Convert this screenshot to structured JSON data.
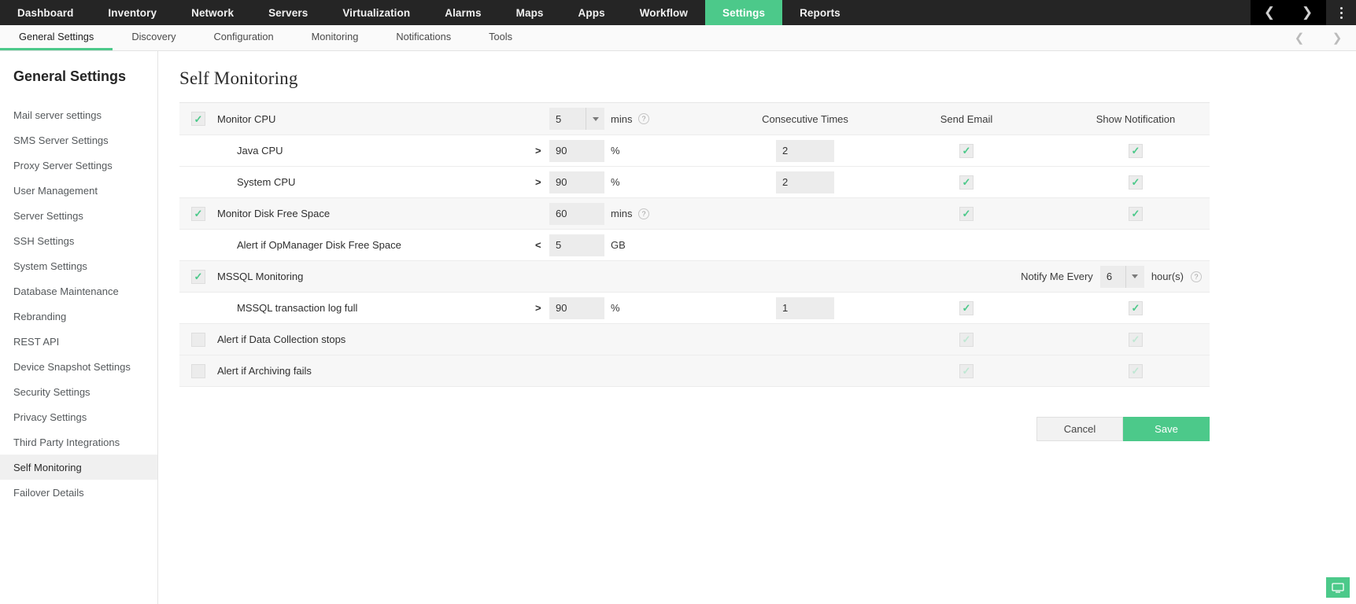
{
  "topnav": {
    "items": [
      {
        "label": "Dashboard",
        "active": false
      },
      {
        "label": "Inventory",
        "active": false
      },
      {
        "label": "Network",
        "active": false
      },
      {
        "label": "Servers",
        "active": false
      },
      {
        "label": "Virtualization",
        "active": false
      },
      {
        "label": "Alarms",
        "active": false
      },
      {
        "label": "Maps",
        "active": false
      },
      {
        "label": "Apps",
        "active": false
      },
      {
        "label": "Workflow",
        "active": false
      },
      {
        "label": "Settings",
        "active": true
      },
      {
        "label": "Reports",
        "active": false
      }
    ],
    "prev_icon": "chevron-left-icon",
    "next_icon": "chevron-right-icon",
    "kebab_icon": "more-vertical-icon"
  },
  "subnav": {
    "items": [
      {
        "label": "General Settings",
        "active": true
      },
      {
        "label": "Discovery",
        "active": false
      },
      {
        "label": "Configuration",
        "active": false
      },
      {
        "label": "Monitoring",
        "active": false
      },
      {
        "label": "Notifications",
        "active": false
      },
      {
        "label": "Tools",
        "active": false
      }
    ]
  },
  "sidebar": {
    "title": "General Settings",
    "items": [
      {
        "label": "Mail server settings",
        "active": false
      },
      {
        "label": "SMS Server Settings",
        "active": false
      },
      {
        "label": "Proxy Server Settings",
        "active": false
      },
      {
        "label": "User Management",
        "active": false
      },
      {
        "label": "Server Settings",
        "active": false
      },
      {
        "label": "SSH Settings",
        "active": false
      },
      {
        "label": "System Settings",
        "active": false
      },
      {
        "label": "Database Maintenance",
        "active": false
      },
      {
        "label": "Rebranding",
        "active": false
      },
      {
        "label": "REST API",
        "active": false
      },
      {
        "label": "Device Snapshot Settings",
        "active": false
      },
      {
        "label": "Security Settings",
        "active": false
      },
      {
        "label": "Privacy Settings",
        "active": false
      },
      {
        "label": "Third Party Integrations",
        "active": false
      },
      {
        "label": "Self Monitoring",
        "active": true
      },
      {
        "label": "Failover Details",
        "active": false
      }
    ]
  },
  "main": {
    "page_title": "Self Monitoring",
    "columns": {
      "consecutive_times": "Consecutive Times",
      "send_email": "Send Email",
      "show_notification": "Show Notification"
    },
    "rows": [
      {
        "id": "monitor-cpu",
        "label": "Monitor CPU",
        "checked": true,
        "interval_value": "5",
        "interval_unit": "mins",
        "help": "?"
      },
      {
        "id": "java-cpu",
        "label": "Java CPU",
        "operator": ">",
        "value": "90",
        "unit": "%",
        "consecutive": "2",
        "send_email": true,
        "show_notification": true
      },
      {
        "id": "system-cpu",
        "label": "System CPU",
        "operator": ">",
        "value": "90",
        "unit": "%",
        "consecutive": "2",
        "send_email": true,
        "show_notification": true
      },
      {
        "id": "monitor-disk-free-space",
        "label": "Monitor Disk Free Space",
        "checked": true,
        "interval_value": "60",
        "interval_unit": "mins",
        "help": "?",
        "send_email": true,
        "show_notification": true
      },
      {
        "id": "alert-opmanager-disk-free-space",
        "label": "Alert if OpManager Disk Free Space",
        "operator": "<",
        "value": "5",
        "unit": "GB"
      },
      {
        "id": "mssql-monitoring",
        "label": "MSSQL Monitoring",
        "checked": true,
        "notify_label": "Notify Me Every",
        "notify_value": "6",
        "notify_unit": "hour(s)",
        "help": "?"
      },
      {
        "id": "mssql-transaction-log-full",
        "label": "MSSQL transaction log full",
        "operator": ">",
        "value": "90",
        "unit": "%",
        "consecutive": "1",
        "send_email": true,
        "show_notification": true
      },
      {
        "id": "alert-data-collection-stops",
        "label": "Alert if Data Collection stops",
        "checked": false,
        "send_email": true,
        "show_notification": true,
        "disabled": true
      },
      {
        "id": "alert-archiving-fails",
        "label": "Alert if Archiving fails",
        "checked": false,
        "send_email": true,
        "show_notification": true,
        "disabled": true
      }
    ],
    "actions": {
      "cancel_label": "Cancel",
      "save_label": "Save"
    }
  },
  "colors": {
    "accent_green": "#4cc98a",
    "topnav_bg": "#252525",
    "input_bg": "#ececec"
  }
}
